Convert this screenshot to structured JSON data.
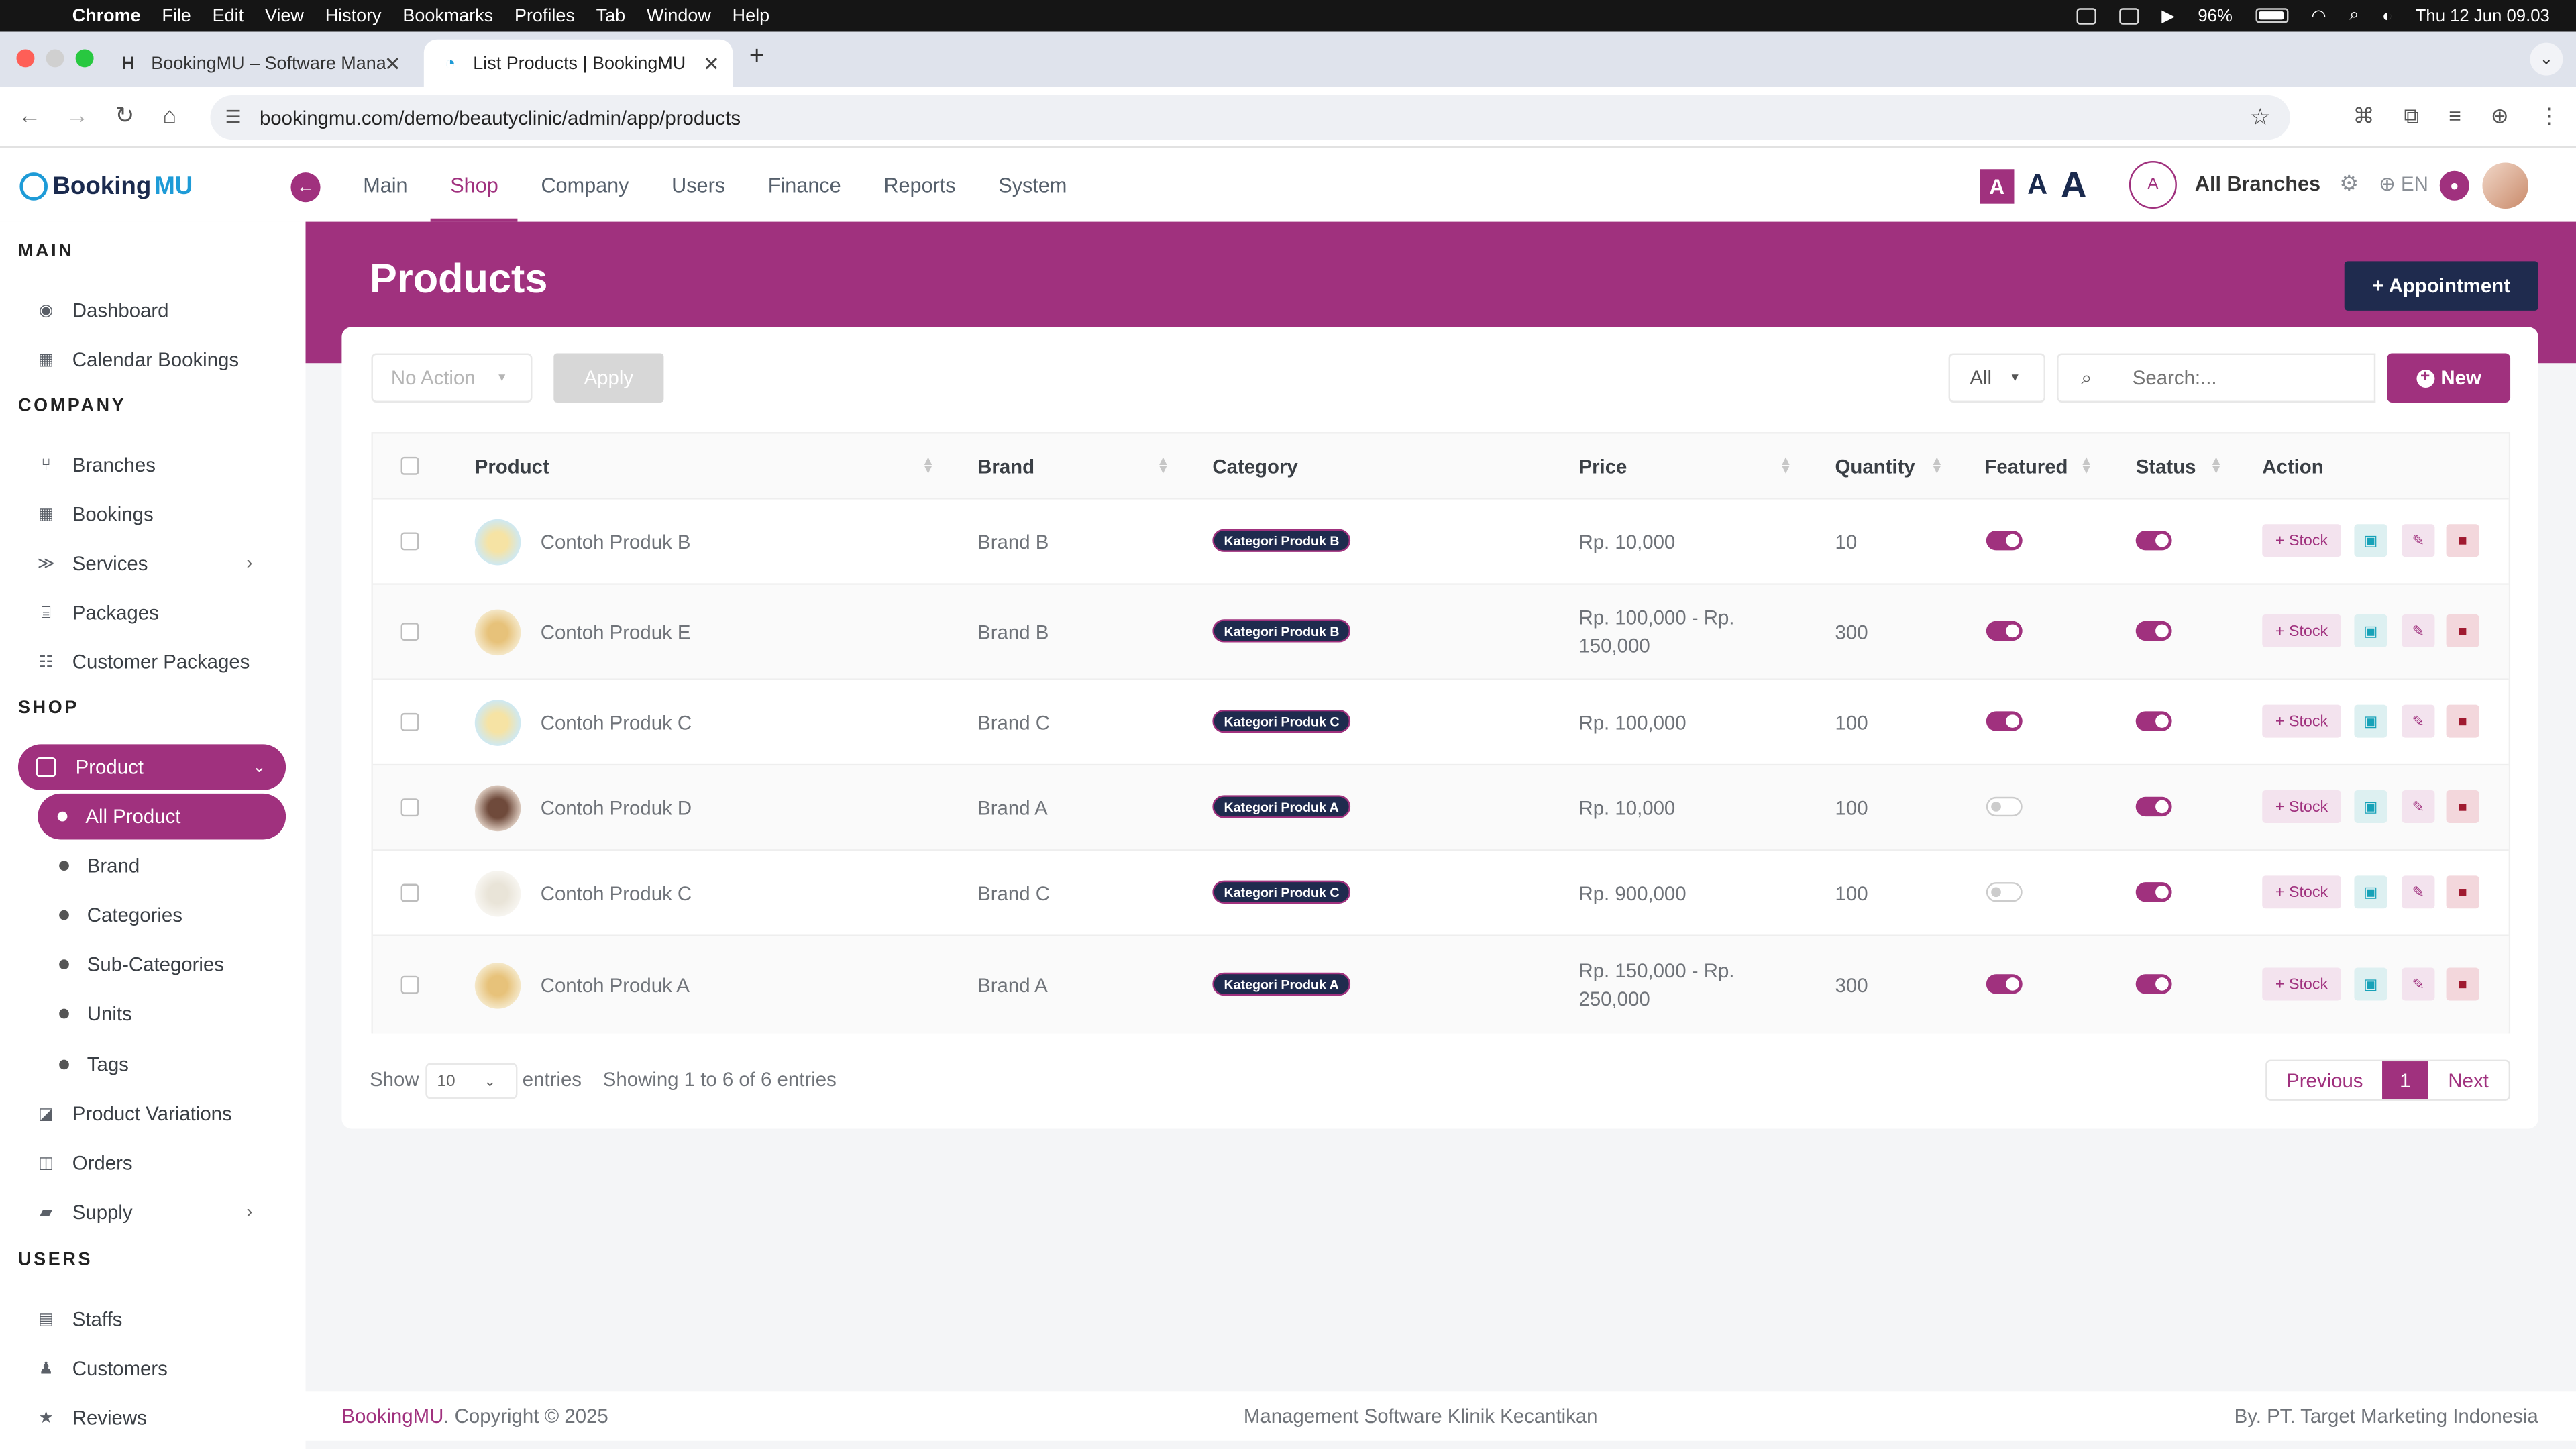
{
  "macbar": {
    "app": "Chrome",
    "menus": [
      "File",
      "Edit",
      "View",
      "History",
      "Bookmarks",
      "Profiles",
      "Tab",
      "Window",
      "Help"
    ],
    "battery": "96%",
    "datetime": "Thu 12 Jun  09.03"
  },
  "browser": {
    "tabs": [
      {
        "title": "BookingMU – Software Mana"
      },
      {
        "title": "List Products | BookingMU"
      }
    ],
    "url": "bookingmu.com/demo/beautyclinic/admin/app/products"
  },
  "header": {
    "logo_booking": "Booking",
    "logo_mu": "MU",
    "nav": [
      "Main",
      "Shop",
      "Company",
      "Users",
      "Finance",
      "Reports",
      "System"
    ],
    "active_nav": "Shop",
    "font_sizes": [
      "A",
      "A",
      "A"
    ],
    "branch_initial": "A",
    "branches": "All Branches",
    "lang": "EN"
  },
  "sidebar": {
    "main_title": "MAIN",
    "main_items": [
      "Dashboard",
      "Calendar Bookings"
    ],
    "company_title": "COMPANY",
    "company_items": [
      "Branches",
      "Bookings",
      "Services",
      "Packages",
      "Customer Packages"
    ],
    "shop_title": "SHOP",
    "product": "Product",
    "product_sub": [
      "All Product",
      "Brand",
      "Categories",
      "Sub-Categories",
      "Units",
      "Tags"
    ],
    "shop_items": [
      "Product Variations",
      "Orders",
      "Supply"
    ],
    "users_title": "USERS",
    "users_items": [
      "Staffs",
      "Customers",
      "Reviews"
    ]
  },
  "page": {
    "title": "Products",
    "appointment_btn": "+ Appointment",
    "bulk_action": "No Action",
    "apply": "Apply",
    "filter": "All",
    "search_placeholder": "Search:...",
    "new_btn": "New"
  },
  "table": {
    "columns": [
      "Product",
      "Brand",
      "Category",
      "Price",
      "Quantity",
      "Featured",
      "Status",
      "Action"
    ],
    "stock_label": "+ Stock",
    "rows": [
      {
        "product": "Contoh Produk B",
        "brand": "Brand B",
        "category": "Kategori Produk B",
        "price_l1": "Rp. 10,000",
        "price_l2": "",
        "quantity": "10",
        "featured": true,
        "status": true
      },
      {
        "product": "Contoh Produk E",
        "brand": "Brand B",
        "category": "Kategori Produk B",
        "price_l1": "Rp. 100,000 - Rp.",
        "price_l2": "150,000",
        "quantity": "300",
        "featured": true,
        "status": true
      },
      {
        "product": "Contoh Produk C",
        "brand": "Brand C",
        "category": "Kategori Produk C",
        "price_l1": "Rp. 100,000",
        "price_l2": "",
        "quantity": "100",
        "featured": true,
        "status": true
      },
      {
        "product": "Contoh Produk D",
        "brand": "Brand A",
        "category": "Kategori Produk A",
        "price_l1": "Rp. 10,000",
        "price_l2": "",
        "quantity": "100",
        "featured": false,
        "status": true
      },
      {
        "product": "Contoh Produk C",
        "brand": "Brand C",
        "category": "Kategori Produk C",
        "price_l1": "Rp. 900,000",
        "price_l2": "",
        "quantity": "100",
        "featured": false,
        "status": true
      },
      {
        "product": "Contoh Produk A",
        "brand": "Brand A",
        "category": "Kategori Produk A",
        "price_l1": "Rp. 150,000 - Rp.",
        "price_l2": "250,000",
        "quantity": "300",
        "featured": true,
        "status": true
      }
    ],
    "show_label": "Show",
    "page_size": "10",
    "entries_label": "entries",
    "showing": "Showing 1 to 6 of 6 entries",
    "prev": "Previous",
    "page": "1",
    "next": "Next"
  },
  "footer": {
    "brand": "BookingMU",
    "copyright": ". Copyright © 2025",
    "center": "Management Software Klinik Kecantikan",
    "by": "By. PT. Target Marketing Indonesia"
  },
  "colors": {
    "accent": "#a0317e",
    "navy": "#1f2b4e"
  }
}
